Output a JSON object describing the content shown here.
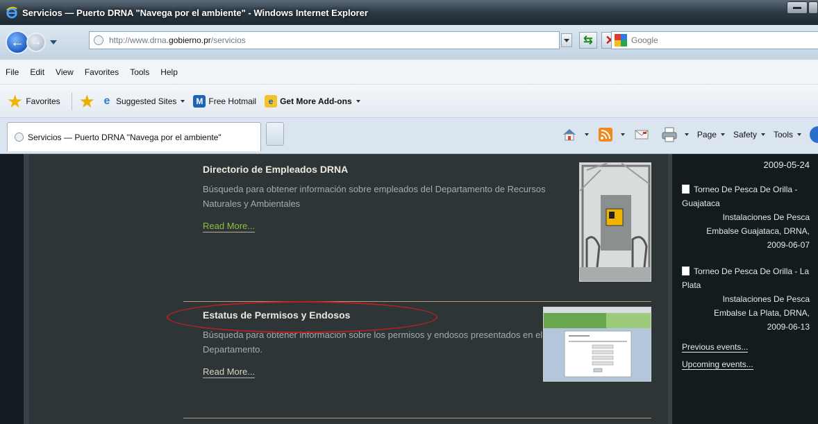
{
  "window": {
    "title": "Servicios — Puerto DRNA \"Navega por el ambiente\" - Windows Internet Explorer"
  },
  "address": {
    "scheme": "http://www.",
    "domain": "drna.",
    "host": "gobierno.pr",
    "path": "/servicios"
  },
  "search": {
    "placeholder": "Google"
  },
  "menu": [
    "File",
    "Edit",
    "View",
    "Favorites",
    "Tools",
    "Help"
  ],
  "favorites": {
    "label": "Favorites",
    "items": [
      {
        "label": "Suggested Sites"
      },
      {
        "label": "Free Hotmail"
      },
      {
        "label": "Get More Add-ons"
      }
    ]
  },
  "tab": {
    "label": "Servicios — Puerto DRNA \"Navega por el ambiente\""
  },
  "commandbar": {
    "page": "Page",
    "safety": "Safety",
    "tools": "Tools"
  },
  "articles": [
    {
      "title": "Directorio de Empleados DRNA",
      "description": "Búsqueda para obtener información sobre empleados del Departamento de Recursos Naturales y Ambientales",
      "read_more": "Read More..."
    },
    {
      "title": "Estatus de Permisos y Endosos",
      "description": "Búsqueda para obtener información sobre los permisos y endosos presentados en el Departamento.",
      "read_more": "Read More..."
    }
  ],
  "sidebar": {
    "top_date": "2009-05-24",
    "events": [
      {
        "title": "Torneo De Pesca De Orilla - Guajataca",
        "location": "Instalaciones De Pesca",
        "place": "Embalse Guajataca, DRNA,",
        "date": "2009-06-07"
      },
      {
        "title": "Torneo De Pesca De Orilla - La Plata",
        "location": "Instalaciones De Pesca",
        "place": "Embalse La Plata, DRNA,",
        "date": "2009-06-13"
      }
    ],
    "previous": "Previous events...",
    "upcoming": "Upcoming events..."
  },
  "colors": {
    "title_text": "#ece9e0",
    "read_more_hover": "#8fbf3c",
    "annotation": "#b61f24"
  }
}
